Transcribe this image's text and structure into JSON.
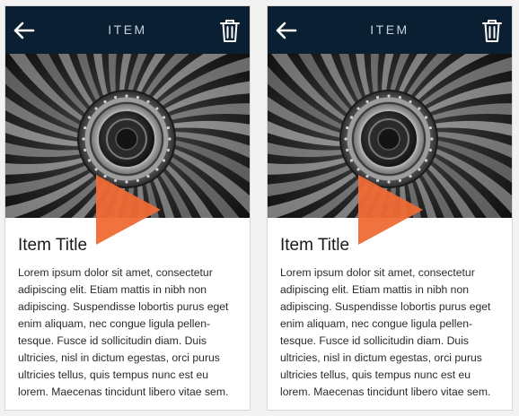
{
  "screens": [
    {
      "header": {
        "title": "ITEM"
      },
      "item": {
        "title": "Item Title",
        "body": "Lorem ipsum dolor sit amet, consectetur adipiscing elit. Etiam mattis in nibh non adipiscing. Suspendisse lobortis purus eget enim aliquam, nec congue ligula pellen-tesque. Fusce id sollicitudin diam. Duis ultricies, nisl in dictum egestas, orci purus ultricies tellus, quis tempus nunc est eu lorem. Maecenas tincidunt libero vitae sem."
      }
    },
    {
      "header": {
        "title": "ITEM"
      },
      "item": {
        "title": "Item Title",
        "body": "Lorem ipsum dolor sit amet, consectetur adipiscing elit. Etiam mattis in nibh non adipiscing. Suspendisse lobortis purus eget enim aliquam, nec congue ligula pellen-tesque. Fusce id sollicitudin diam. Duis ultricies, nisl in dictum egestas, orci purus ultricies tellus, quis tempus nunc est eu lorem. Maecenas tincidunt libero vitae sem."
      }
    }
  ],
  "icons": {
    "back": "arrow-left-icon",
    "delete": "trash-icon",
    "play": "play-icon"
  },
  "colors": {
    "header_bg": "#0b1f33",
    "header_text": "#c9d2db",
    "accent": "#ef6a35",
    "card_bg": "#ffffff",
    "page_bg": "#f2f2f2"
  }
}
